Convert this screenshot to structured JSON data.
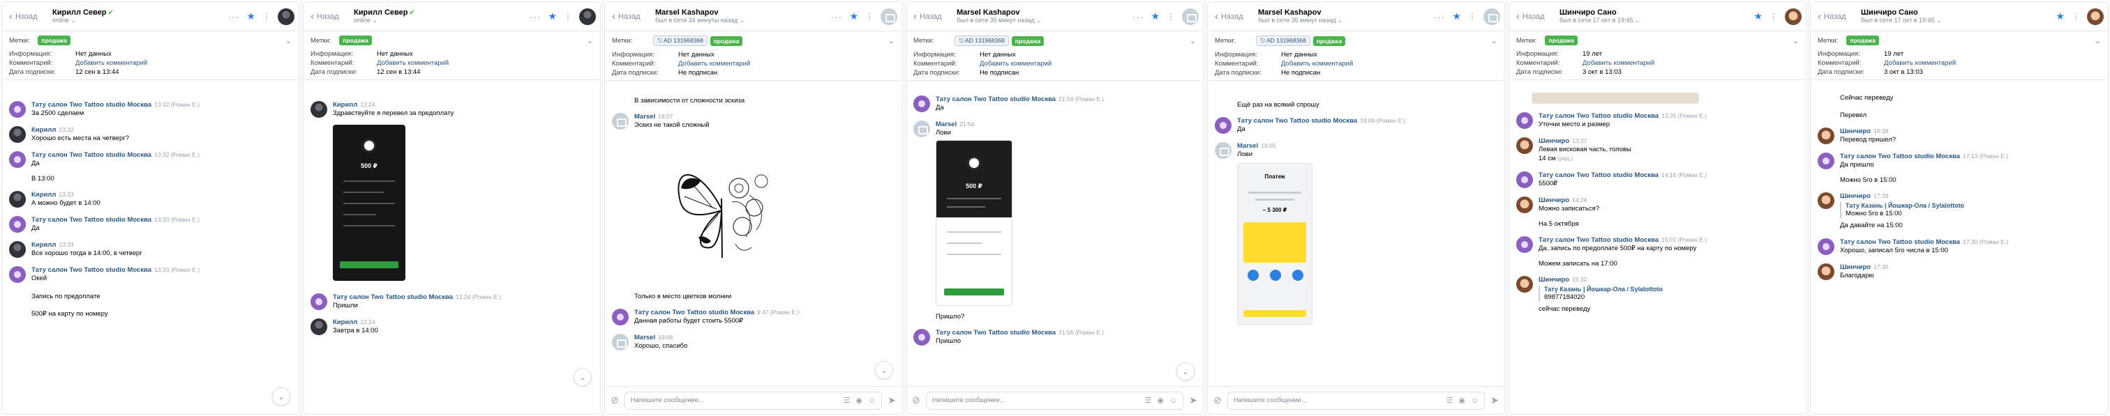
{
  "common": {
    "back_label": "Назад",
    "labels_title": "Метки:",
    "info_label": "Информация:",
    "comment_label": "Комментарий:",
    "sub_label": "Дата подписки:",
    "no_data": "Нет данных",
    "add_comment": "Добавить комментарий",
    "not_subscribed": "Не подписан",
    "tag_sale": "продажа",
    "ad_tag": "AD 131968368",
    "composer_placeholder": "Напишите сообщение...",
    "colors": {
      "link": "#2a5885",
      "green_tag": "#4bb34b",
      "accent": "#2d81e0"
    }
  },
  "panels": [
    {
      "name": "Кирилл Север",
      "status": "online",
      "info": "Нет данных",
      "sub_date": "12 сен в 13:44",
      "messages": [
        {
          "author": "Тату салон Two Tattoo studio Москва",
          "time": "13:32 (Роман Е.)",
          "text": "За 2500 сделаем"
        },
        {
          "author": "Кирилл",
          "time": "13:32",
          "text": "Хорошо есть места на четверг?"
        },
        {
          "author": "Тату салон Two Tattoo studio Москва",
          "time": "13:32 (Роман Е.)",
          "text": "Да",
          "extra": "В 13:00"
        },
        {
          "author": "Кирилл",
          "time": "13:33",
          "text": "А можно будет в 14:00"
        },
        {
          "author": "Тату салон Two Tattoo studio Москва",
          "time": "13:33 (Роман Е.)",
          "text": "Да"
        },
        {
          "author": "Кирилл",
          "time": "13:33",
          "text": "Все хорошо тогда в 14:00, в четверг"
        },
        {
          "author": "Тату салон Two Tattoo studio Москва",
          "time": "13:33 (Роман Е.)",
          "text": "Окей",
          "extra": "Запись по предоплате",
          "extra2": "500₽ на карту по номеру"
        }
      ]
    },
    {
      "name": "Кирилл Север",
      "status": "online",
      "info": "Нет данных",
      "sub_date": "12 сен в 13:44",
      "messages": [
        {
          "author": "Кирилл",
          "time": "12:24",
          "text": "Здравствуйте я перевел за предоплату"
        },
        {
          "author": "Тату салон Two Tattoo studio Москва",
          "time": "12:24 (Роман Е.)",
          "text": "Пришли"
        },
        {
          "author": "Кирилл",
          "time": "12:24",
          "text": "Завтра в 14:00"
        }
      ],
      "transfer_amount": "500 ₽"
    },
    {
      "name": "Marsel Kashapov",
      "status": "был в сети 34 минуты назад",
      "info": "Нет данных",
      "sub_date": "Не подписан",
      "top_text": "В зависимости от сложности эскиза",
      "messages": [
        {
          "author": "Marsel",
          "time": "18:57",
          "text": "Эскиз не такой сложный"
        },
        {
          "author": "",
          "time": "",
          "text": "Только в место цветков молнии"
        },
        {
          "author": "Тату салон Two Tattoo studio Москва",
          "time": "9:47 (Роман Е.)",
          "text": "Данная работы будет стоить 5500₽"
        },
        {
          "author": "Marsel",
          "time": "19:06",
          "text": "Хорошо, спасибо"
        }
      ]
    },
    {
      "name": "Marsel Kashapov",
      "status": "был в сети 35 минут назад",
      "info": "Нет данных",
      "sub_date": "Не подписан",
      "messages": [
        {
          "author": "Тату салон Two Tattoo studio Москва",
          "time": "21:54 (Роман Е.)",
          "text": "Да"
        },
        {
          "author": "Marsel",
          "time": "21:54",
          "text": "Лови"
        },
        {
          "author": "",
          "time": "",
          "text": "Пришло?"
        },
        {
          "author": "Тату салон Two Tattoo studio Москва",
          "time": "21:56 (Роман Е.)",
          "text": "Пришло"
        }
      ],
      "transfer_amount": "500 ₽"
    },
    {
      "name": "Marsel Kashapov",
      "status": "был в сети 35 минут назад",
      "info": "Нет данных",
      "sub_date": "Не подписан",
      "top_text": "Ещё раз на всякий спрошу",
      "messages": [
        {
          "author": "Тату салон Two Tattoo studio Москва",
          "time": "19:00 (Роман Е.)",
          "text": "Да"
        },
        {
          "author": "Marsel",
          "time": "19:05",
          "text": "Лови"
        }
      ],
      "pay_amount": "− 5 300 ₽",
      "pay_title": "Платеж"
    },
    {
      "name": "Шинчиро Сано",
      "status": "был в сети 17 окт в 19:45",
      "info": "19 лет",
      "sub_date": "3 окт в 13:03",
      "messages": [
        {
          "author": "Тату салон Two Tattoo studio Москва",
          "time": "13:35 (Роман Е.)",
          "text": "Уточни место и размер"
        },
        {
          "author": "Шинчиро",
          "time": "13:37",
          "text": "Левая висковая часть, головы",
          "extra": "14 см"
        },
        {
          "author": "Тату салон Two Tattoo studio Москва",
          "time": "14:16 (Роман Е.)",
          "text": "5500₽"
        },
        {
          "author": "Шинчиро",
          "time": "14:24",
          "text": "Можно записаться?",
          "extra": "На 5 октября"
        },
        {
          "author": "Тату салон Two Tattoo studio Москва",
          "time": "15:01 (Роман Е.)",
          "text": "Да, запись по предоплате 500₽ на карту по номеру",
          "extra": "Можем записать на 17:00"
        },
        {
          "author": "Шинчиро",
          "time": "15:32",
          "fwd_author": "Тату Казань | Йошкар-Ола / Sylalottoto",
          "fwd_text": "89877184020",
          "text": "сейчас переведу"
        }
      ],
      "edited_label": "(ред.)"
    },
    {
      "name": "Шинчиро Сано",
      "status": "был в сети 17 окт в 19:45",
      "info": "19 лет",
      "sub_date": "3 окт в 13:03",
      "top_text": "Сейчас переведу",
      "top_text2": "Перевел",
      "messages": [
        {
          "author": "Шинчиро",
          "time": "16:28",
          "text": "Перевод пришел?"
        },
        {
          "author": "Тату салон Two Tattoo studio Москва",
          "time": "17:13 (Роман Е.)",
          "text": "Да пришло",
          "extra": "Можно 5го в 15:00"
        },
        {
          "author": "Шинчиро",
          "time": "17:29",
          "fwd_author": "Тату Казань | Йошкар-Ола / Sylalottoto",
          "fwd_text": "Можно 5го в 15:00",
          "text": "Да давайте на 15:00"
        },
        {
          "author": "Тату салон Two Tattoo studio Москва",
          "time": "17:30 (Роман Е.)",
          "text": "Хорошо, записал 5го числа в 15:00"
        },
        {
          "author": "Шинчиро",
          "time": "17:30",
          "text": "Благодарю"
        }
      ]
    }
  ]
}
